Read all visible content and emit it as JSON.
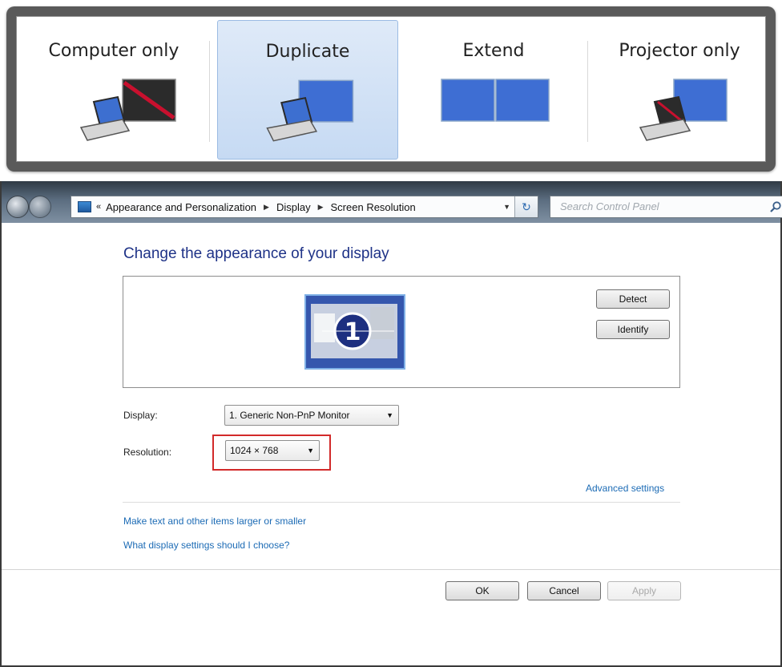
{
  "switcher": {
    "options": [
      {
        "label": "Computer only",
        "selected": false
      },
      {
        "label": "Duplicate",
        "selected": true
      },
      {
        "label": "Extend",
        "selected": false
      },
      {
        "label": "Projector only",
        "selected": false
      }
    ]
  },
  "window": {
    "breadcrumb": [
      "Appearance and Personalization",
      "Display",
      "Screen Resolution"
    ],
    "search_placeholder": "Search Control Panel"
  },
  "page": {
    "heading": "Change the appearance of your display",
    "monitor_number": "1",
    "detect_label": "Detect",
    "identify_label": "Identify",
    "display_label": "Display:",
    "display_value": "1. Generic Non-PnP Monitor",
    "resolution_label": "Resolution:",
    "resolution_value": "1024 × 768",
    "advanced_link": "Advanced settings",
    "link_text_size": "Make text and other items larger or smaller",
    "link_display_help": "What display settings should I choose?"
  },
  "footer": {
    "ok_label": "OK",
    "cancel_label": "Cancel",
    "apply_label": "Apply"
  },
  "colors": {
    "selected_option_bg": "#c6daf3",
    "highlight_border": "#d22a2a",
    "link": "#1c6bb5",
    "heading": "#1e3287"
  }
}
